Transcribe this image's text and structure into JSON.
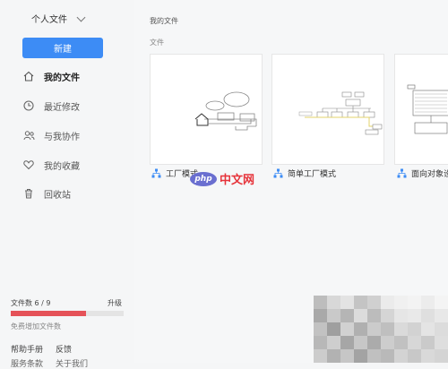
{
  "sidebar": {
    "workspace": "个人文件",
    "new_button": "新建",
    "nav": [
      {
        "label": "我的文件",
        "icon": "home-icon"
      },
      {
        "label": "最近修改",
        "icon": "clock-icon"
      },
      {
        "label": "与我协作",
        "icon": "people-icon"
      },
      {
        "label": "我的收藏",
        "icon": "heart-icon"
      },
      {
        "label": "回收站",
        "icon": "trash-icon"
      }
    ],
    "quota": {
      "label": "文件数 6 / 9",
      "upgrade": "升级",
      "used": 6,
      "total": 9,
      "sub": "免费增加文件数"
    },
    "help": "帮助手册",
    "feedback": "反馈",
    "footer_cut_1": "服务条款",
    "footer_cut_2": "关于我们"
  },
  "main": {
    "title": "我的文件",
    "section": "文件",
    "files": [
      {
        "name": "工厂模式",
        "icon": "org-chart-icon"
      },
      {
        "name": "简单工厂模式",
        "icon": "org-chart-icon"
      },
      {
        "name": "面向对象设计"
      }
    ]
  },
  "watermark": {
    "logo": "php",
    "text": "中文网"
  },
  "colors": {
    "accent": "#3d8cf5",
    "quota": "#e55258",
    "watermark": "#e6333a"
  }
}
